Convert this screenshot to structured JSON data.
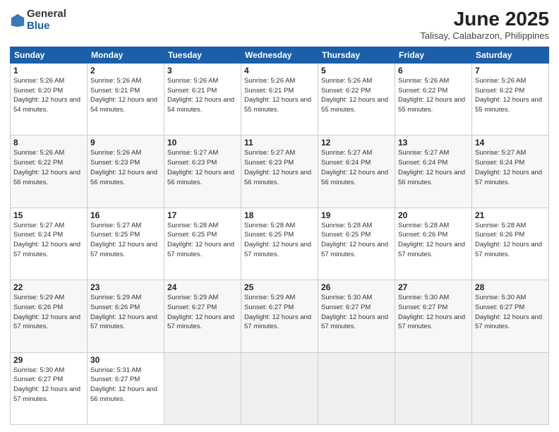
{
  "logo": {
    "general": "General",
    "blue": "Blue"
  },
  "title": "June 2025",
  "location": "Talisay, Calabarzon, Philippines",
  "days": [
    "Sunday",
    "Monday",
    "Tuesday",
    "Wednesday",
    "Thursday",
    "Friday",
    "Saturday"
  ],
  "weeks": [
    [
      {
        "day": "1",
        "sunrise": "5:26 AM",
        "sunset": "6:20 PM",
        "daylight": "12 hours and 54 minutes."
      },
      {
        "day": "2",
        "sunrise": "5:26 AM",
        "sunset": "6:21 PM",
        "daylight": "12 hours and 54 minutes."
      },
      {
        "day": "3",
        "sunrise": "5:26 AM",
        "sunset": "6:21 PM",
        "daylight": "12 hours and 54 minutes."
      },
      {
        "day": "4",
        "sunrise": "5:26 AM",
        "sunset": "6:21 PM",
        "daylight": "12 hours and 55 minutes."
      },
      {
        "day": "5",
        "sunrise": "5:26 AM",
        "sunset": "6:22 PM",
        "daylight": "12 hours and 55 minutes."
      },
      {
        "day": "6",
        "sunrise": "5:26 AM",
        "sunset": "6:22 PM",
        "daylight": "12 hours and 55 minutes."
      },
      {
        "day": "7",
        "sunrise": "5:26 AM",
        "sunset": "6:22 PM",
        "daylight": "12 hours and 55 minutes."
      }
    ],
    [
      {
        "day": "8",
        "sunrise": "5:26 AM",
        "sunset": "6:22 PM",
        "daylight": "12 hours and 56 minutes."
      },
      {
        "day": "9",
        "sunrise": "5:26 AM",
        "sunset": "6:23 PM",
        "daylight": "12 hours and 56 minutes."
      },
      {
        "day": "10",
        "sunrise": "5:27 AM",
        "sunset": "6:23 PM",
        "daylight": "12 hours and 56 minutes."
      },
      {
        "day": "11",
        "sunrise": "5:27 AM",
        "sunset": "6:23 PM",
        "daylight": "12 hours and 56 minutes."
      },
      {
        "day": "12",
        "sunrise": "5:27 AM",
        "sunset": "6:24 PM",
        "daylight": "12 hours and 56 minutes."
      },
      {
        "day": "13",
        "sunrise": "5:27 AM",
        "sunset": "6:24 PM",
        "daylight": "12 hours and 56 minutes."
      },
      {
        "day": "14",
        "sunrise": "5:27 AM",
        "sunset": "6:24 PM",
        "daylight": "12 hours and 57 minutes."
      }
    ],
    [
      {
        "day": "15",
        "sunrise": "5:27 AM",
        "sunset": "6:24 PM",
        "daylight": "12 hours and 57 minutes."
      },
      {
        "day": "16",
        "sunrise": "5:27 AM",
        "sunset": "6:25 PM",
        "daylight": "12 hours and 57 minutes."
      },
      {
        "day": "17",
        "sunrise": "5:28 AM",
        "sunset": "6:25 PM",
        "daylight": "12 hours and 57 minutes."
      },
      {
        "day": "18",
        "sunrise": "5:28 AM",
        "sunset": "6:25 PM",
        "daylight": "12 hours and 57 minutes."
      },
      {
        "day": "19",
        "sunrise": "5:28 AM",
        "sunset": "6:25 PM",
        "daylight": "12 hours and 57 minutes."
      },
      {
        "day": "20",
        "sunrise": "5:28 AM",
        "sunset": "6:26 PM",
        "daylight": "12 hours and 57 minutes."
      },
      {
        "day": "21",
        "sunrise": "5:28 AM",
        "sunset": "6:26 PM",
        "daylight": "12 hours and 57 minutes."
      }
    ],
    [
      {
        "day": "22",
        "sunrise": "5:29 AM",
        "sunset": "6:26 PM",
        "daylight": "12 hours and 57 minutes."
      },
      {
        "day": "23",
        "sunrise": "5:29 AM",
        "sunset": "6:26 PM",
        "daylight": "12 hours and 57 minutes."
      },
      {
        "day": "24",
        "sunrise": "5:29 AM",
        "sunset": "6:27 PM",
        "daylight": "12 hours and 57 minutes."
      },
      {
        "day": "25",
        "sunrise": "5:29 AM",
        "sunset": "6:27 PM",
        "daylight": "12 hours and 57 minutes."
      },
      {
        "day": "26",
        "sunrise": "5:30 AM",
        "sunset": "6:27 PM",
        "daylight": "12 hours and 57 minutes."
      },
      {
        "day": "27",
        "sunrise": "5:30 AM",
        "sunset": "6:27 PM",
        "daylight": "12 hours and 57 minutes."
      },
      {
        "day": "28",
        "sunrise": "5:30 AM",
        "sunset": "6:27 PM",
        "daylight": "12 hours and 57 minutes."
      }
    ],
    [
      {
        "day": "29",
        "sunrise": "5:30 AM",
        "sunset": "6:27 PM",
        "daylight": "12 hours and 57 minutes."
      },
      {
        "day": "30",
        "sunrise": "5:31 AM",
        "sunset": "6:27 PM",
        "daylight": "12 hours and 56 minutes."
      },
      null,
      null,
      null,
      null,
      null
    ]
  ]
}
